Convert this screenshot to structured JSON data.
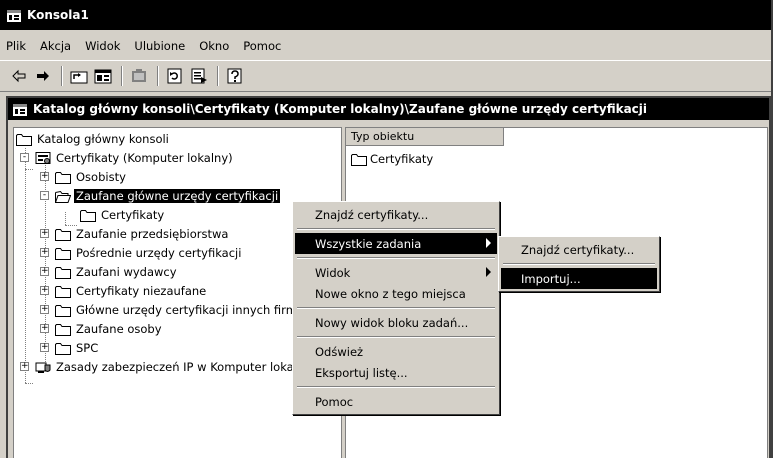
{
  "window": {
    "title": "Konsola1"
  },
  "menubar": [
    "Plik",
    "Akcja",
    "Widok",
    "Ulubione",
    "Okno",
    "Pomoc"
  ],
  "toolbar": {
    "icons": [
      "back-arrow-icon",
      "forward-arrow-icon",
      "up-level-icon",
      "show-hide-tree-icon",
      "delete-icon",
      "refresh-icon",
      "export-list-icon",
      "help-icon"
    ]
  },
  "console_window": {
    "title": "Katalog główny konsoli\\Certyfikaty (Komputer lokalny)\\Zaufane główne urzędy certyfikacji"
  },
  "tree": [
    {
      "label": "Katalog główny konsoli",
      "level": 0,
      "icon": "folder-icon",
      "expander": ""
    },
    {
      "label": "Certyfikaty (Komputer lokalny)",
      "level": 1,
      "icon": "certificate-snapin-icon",
      "expander": "-"
    },
    {
      "label": "Osobisty",
      "level": 2,
      "icon": "folder-icon",
      "expander": "+"
    },
    {
      "label": "Zaufane główne urzędy certyfikacji",
      "level": 2,
      "icon": "open-folder-icon",
      "expander": "-",
      "selected": true
    },
    {
      "label": "Certyfikaty",
      "level": 3,
      "icon": "folder-icon",
      "expander": ""
    },
    {
      "label": "Zaufanie przedsiębiorstwa",
      "level": 2,
      "icon": "folder-icon",
      "expander": "+"
    },
    {
      "label": "Pośrednie urzędy certyfikacji",
      "level": 2,
      "icon": "folder-icon",
      "expander": "+"
    },
    {
      "label": "Zaufani wydawcy",
      "level": 2,
      "icon": "folder-icon",
      "expander": "+"
    },
    {
      "label": "Certyfikaty niezaufane",
      "level": 2,
      "icon": "folder-icon",
      "expander": "+"
    },
    {
      "label": "Główne urzędy certyfikacji innych firm",
      "level": 2,
      "icon": "folder-icon",
      "expander": "+"
    },
    {
      "label": "Zaufane osoby",
      "level": 2,
      "icon": "folder-icon",
      "expander": "+"
    },
    {
      "label": "SPC",
      "level": 2,
      "icon": "folder-icon",
      "expander": "+"
    },
    {
      "label": "Zasady zabezpieczeń IP w Komputer lokalny",
      "level": 0,
      "icon": "ip-security-icon",
      "expander": "+"
    }
  ],
  "list": {
    "column_header": "Typ obiektu",
    "items": [
      "Certyfikaty"
    ]
  },
  "context_menu": {
    "items": [
      {
        "label": "Znajdź certyfikaty..."
      },
      {
        "sep": true
      },
      {
        "label": "Wszystkie zadania",
        "submenu": true,
        "highlighted": true
      },
      {
        "sep": true
      },
      {
        "label": "Widok",
        "submenu": true
      },
      {
        "label": "Nowe okno z tego miejsca"
      },
      {
        "sep": true
      },
      {
        "label": "Nowy widok bloku zadań..."
      },
      {
        "sep": true
      },
      {
        "label": "Odśwież"
      },
      {
        "label": "Eksportuj listę..."
      },
      {
        "sep": true
      },
      {
        "label": "Pomoc"
      }
    ]
  },
  "submenu": {
    "items": [
      {
        "label": "Znajdź certyfikaty..."
      },
      {
        "sep": true
      },
      {
        "label": "Importuj...",
        "highlighted": true
      }
    ]
  }
}
